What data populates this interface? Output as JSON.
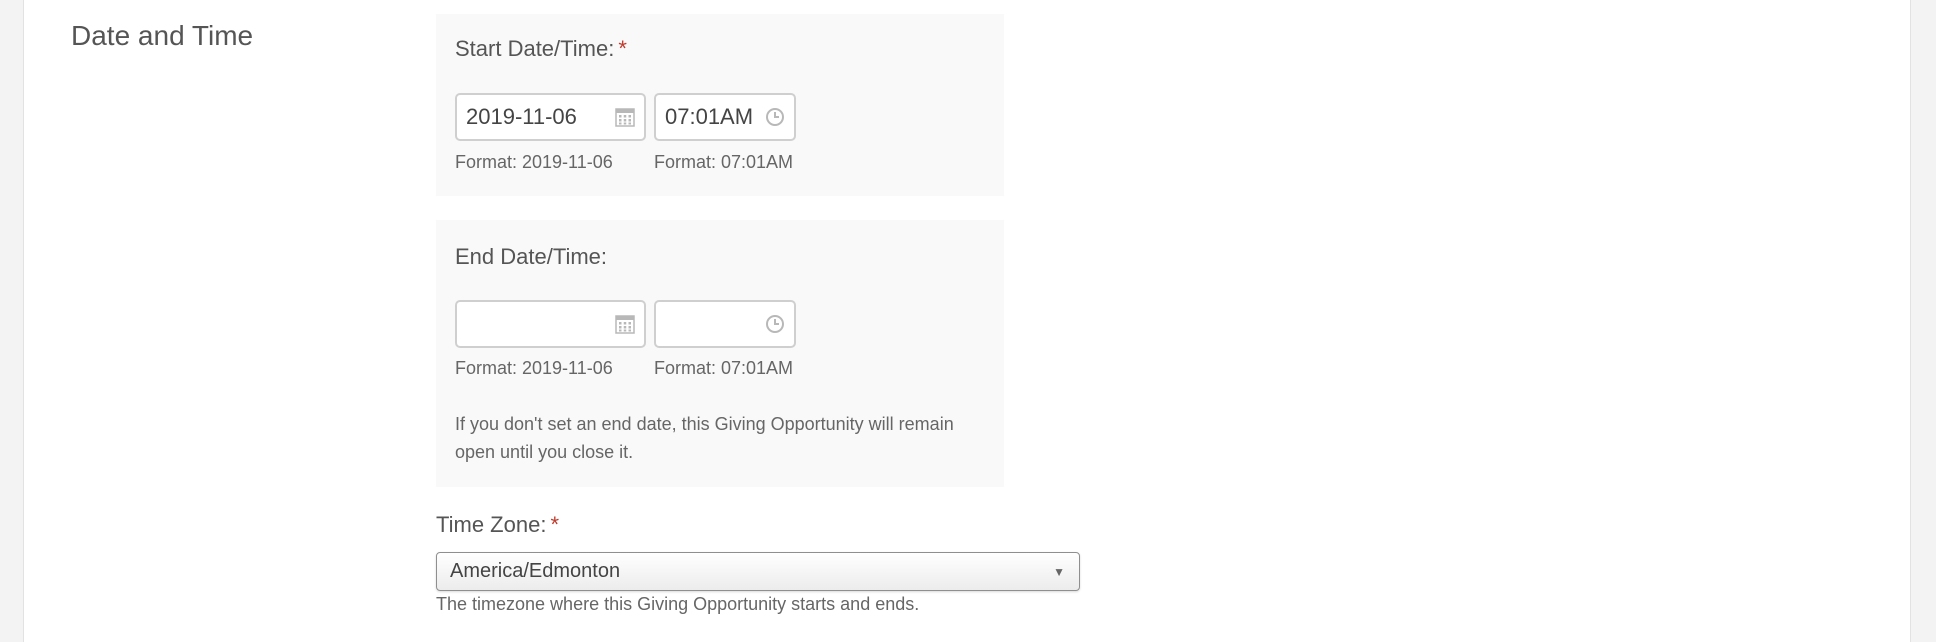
{
  "section": {
    "title": "Date and Time"
  },
  "start": {
    "label": "Start Date/Time:",
    "required_mark": "*",
    "date_value": "2019-11-06",
    "time_value": "07:01AM",
    "date_format": "Format: 2019-11-06",
    "time_format": "Format: 07:01AM"
  },
  "end": {
    "label": "End Date/Time:",
    "date_value": "",
    "time_value": "",
    "date_format": "Format: 2019-11-06",
    "time_format": "Format: 07:01AM",
    "help_text": "If you don't set an end date, this Giving Opportunity will remain open until you close it."
  },
  "timezone": {
    "label": "Time Zone:",
    "required_mark": "*",
    "selected": "America/Edmonton",
    "help_text": "The timezone where this Giving Opportunity starts and ends."
  },
  "icons": {
    "date": "calendar-icon",
    "time": "clock-icon",
    "select": "chevron-down-icon"
  },
  "colors": {
    "required": "#c0392b",
    "panel_bg": "#f9f9f9",
    "text": "#555555"
  }
}
